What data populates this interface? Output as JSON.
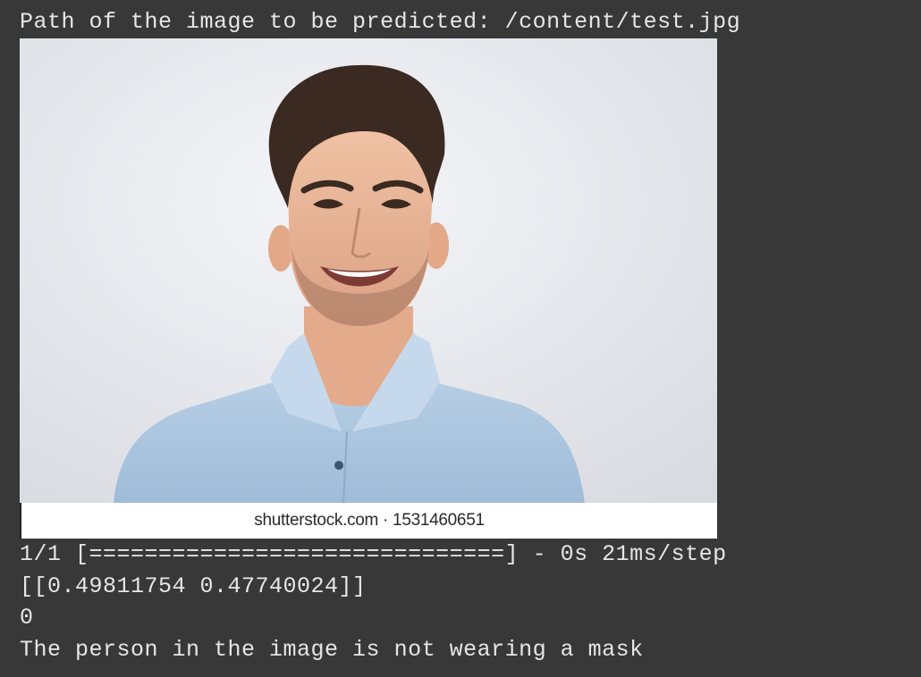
{
  "output": {
    "path_line": "Path of the image to be predicted: /content/test.jpg",
    "image": {
      "watermark": "shutterstock.com · 1531460651"
    },
    "progress_line": "1/1 [==============================] - 0s 21ms/step",
    "probabilities_line": "[[0.49811754 0.47740024]]",
    "predicted_class_line": "0",
    "result_line": "The person in the image is not wearing a mask"
  }
}
